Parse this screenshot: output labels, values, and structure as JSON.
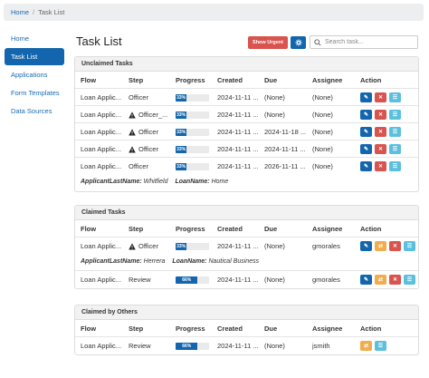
{
  "breadcrumb": {
    "home": "Home",
    "separator": "/",
    "current": "Task List"
  },
  "sidebar": {
    "items": [
      {
        "label": "Home",
        "active": false
      },
      {
        "label": "Task List",
        "active": true
      },
      {
        "label": "Applications",
        "active": false
      },
      {
        "label": "Form Templates",
        "active": false
      },
      {
        "label": "Data Sources",
        "active": false
      }
    ]
  },
  "header": {
    "title": "Task List",
    "urgent_label": "Show Urgent",
    "tool_icon": "settings-icon",
    "search_placeholder": "Search task..."
  },
  "columns": {
    "flow": "Flow",
    "step": "Step",
    "progress": "Progress",
    "created": "Created",
    "due": "Due",
    "assignee": "Assignee",
    "action": "Action"
  },
  "sections": {
    "unclaimed": {
      "title": "Unclaimed Tasks",
      "rows": [
        {
          "flow": "Loan Applic...",
          "step": "Officer",
          "progress": "33%",
          "created": "2024-11-11 ...",
          "due": "(None)",
          "assignee": "(None)"
        },
        {
          "flow": "Loan Applic...",
          "step": "Officer_...",
          "progress": "33%",
          "created": "2024-11-11 ...",
          "due": "(None)",
          "assignee": "(None)"
        },
        {
          "flow": "Loan Applic...",
          "step": "Officer",
          "progress": "33%",
          "created": "2024-11-11 ...",
          "due": "2024-11-18 ...",
          "assignee": "(None)"
        },
        {
          "flow": "Loan Applic...",
          "step": "Officer",
          "progress": "33%",
          "created": "2024-11-11 ...",
          "due": "2024-11-11 ...",
          "assignee": "(None)"
        },
        {
          "flow": "Loan Applic...",
          "step": "Officer",
          "progress": "33%",
          "created": "2024-11-11 ...",
          "due": "2026-11-11 ...",
          "assignee": "(None)",
          "meta": [
            {
              "key": "ApplicantLastName:",
              "value": "Whitfield"
            },
            {
              "key": "LoanName:",
              "value": "Home"
            }
          ]
        }
      ]
    },
    "claimed": {
      "title": "Claimed Tasks",
      "rows": [
        {
          "flow": "Loan Applic...",
          "step": "Officer",
          "progress": "33%",
          "created": "2024-11-11 ...",
          "due": "(None)",
          "assignee": "gmorales",
          "meta": [
            {
              "key": "ApplicantLastName:",
              "value": "Herrera"
            },
            {
              "key": "LoanName:",
              "value": "Nautical Business"
            }
          ]
        },
        {
          "flow": "Loan Applic...",
          "step": "Review",
          "progress": "66%",
          "created": "2024-11-11 ...",
          "due": "(None)",
          "assignee": "gmorales"
        }
      ]
    },
    "others": {
      "title": "Claimed by Others",
      "rows": [
        {
          "flow": "Loan Applic...",
          "step": "Review",
          "progress": "66%",
          "created": "2024-11-11 ...",
          "due": "(None)",
          "assignee": "jsmith"
        }
      ]
    }
  },
  "action_icons": {
    "open": "edit-icon",
    "release": "close-icon",
    "claim": "claim-icon",
    "list": "list-icon"
  },
  "colors": {
    "primary": "#1366ad",
    "danger": "#d9534f",
    "info": "#5bc0de",
    "warning": "#f0ad4e"
  }
}
